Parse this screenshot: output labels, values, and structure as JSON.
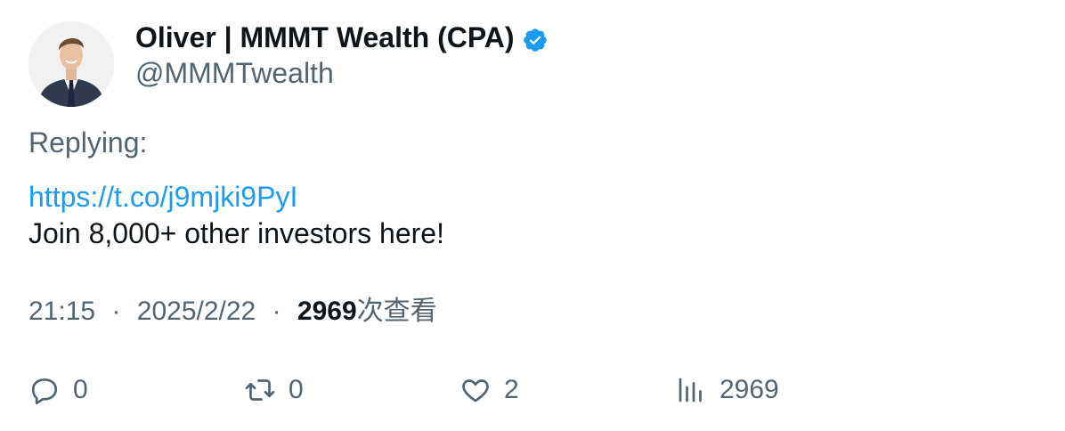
{
  "author": {
    "display_name": "Oliver | MMMT Wealth (CPA)",
    "handle": "@MMMTwealth",
    "verified_icon": "verified-badge-icon",
    "avatar_icon": "profile-photo"
  },
  "tweet": {
    "replying_label": "Replying:",
    "link": "https://t.co/j9mjki9PyI",
    "text": "Join 8,000+ other investors here!",
    "time": "21:15",
    "separator": "·",
    "date": "2025/2/22",
    "views": "2969",
    "views_suffix": "次查看"
  },
  "actions": {
    "reply": {
      "icon": "reply-icon",
      "count": "0"
    },
    "retweet": {
      "icon": "retweet-icon",
      "count": "0"
    },
    "like": {
      "icon": "heart-icon",
      "count": "2"
    },
    "views": {
      "icon": "analytics-icon",
      "count": "2969"
    }
  },
  "colors": {
    "accent": "#1d9bf0",
    "secondary_text": "#536471",
    "primary_text": "#0f1419"
  }
}
